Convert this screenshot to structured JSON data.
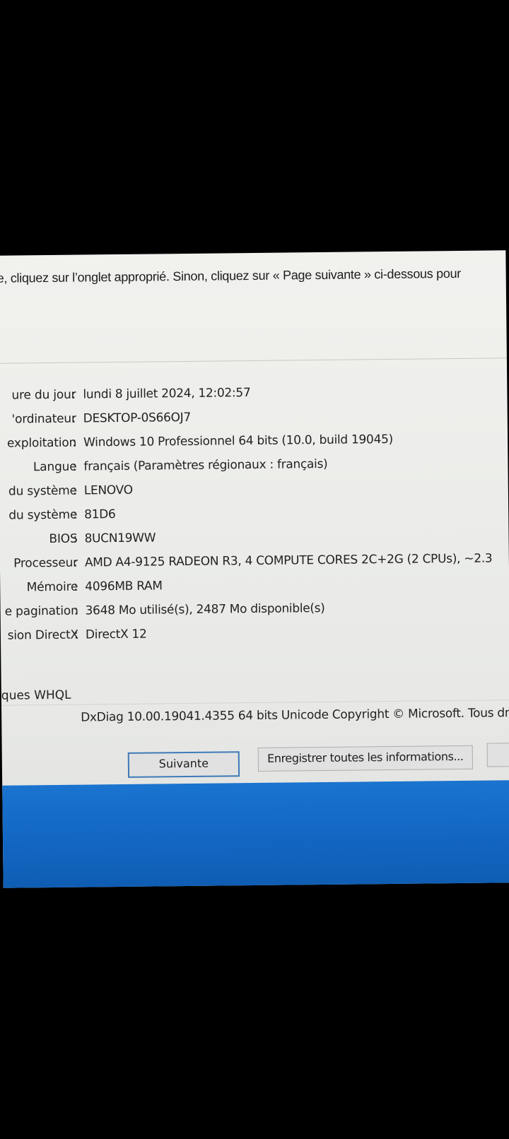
{
  "intro_text": "e, cliquez sur l’onglet approprié. Sinon, cliquez sur « Page suivante » ci-dessous pour",
  "system_info": [
    {
      "label": "ure du jour",
      "value": "lundi 8 juillet 2024, 12:02:57"
    },
    {
      "label": "'ordinateur",
      "value": "DESKTOP-0S66OJ7"
    },
    {
      "label": "exploitation",
      "value": "Windows 10 Professionnel 64 bits (10.0, build 19045)"
    },
    {
      "label": "Langue",
      "value": "français (Paramètres régionaux : français)"
    },
    {
      "label": "du système",
      "value": "LENOVO"
    },
    {
      "label": "du système",
      "value": "81D6"
    },
    {
      "label": "BIOS",
      "value": "8UCN19WW"
    },
    {
      "label": "Processeur",
      "value": "AMD A4-9125 RADEON R3, 4 COMPUTE CORES 2C+2G    (2 CPUs), ~2.3"
    },
    {
      "label": "Mémoire",
      "value": "4096MB RAM"
    },
    {
      "label": "e pagination",
      "value": "3648 Mo utilisé(s), 2487 Mo disponible(s)"
    },
    {
      "label": "sion DirectX",
      "value": "DirectX 12"
    }
  ],
  "colon": ":",
  "whql_text": "ques WHQL",
  "copyright_text": "DxDiag 10.00.19041.4355 64 bits Unicode Copyright © Microsoft. Tous dro",
  "buttons": {
    "next_label": "Suivante",
    "save_label": "Enregistrer toutes les informations...",
    "third_label": ""
  },
  "colors": {
    "window_background": "#ecedea",
    "taskbar": "#1368c4",
    "focus_border": "#3d7ab8"
  }
}
